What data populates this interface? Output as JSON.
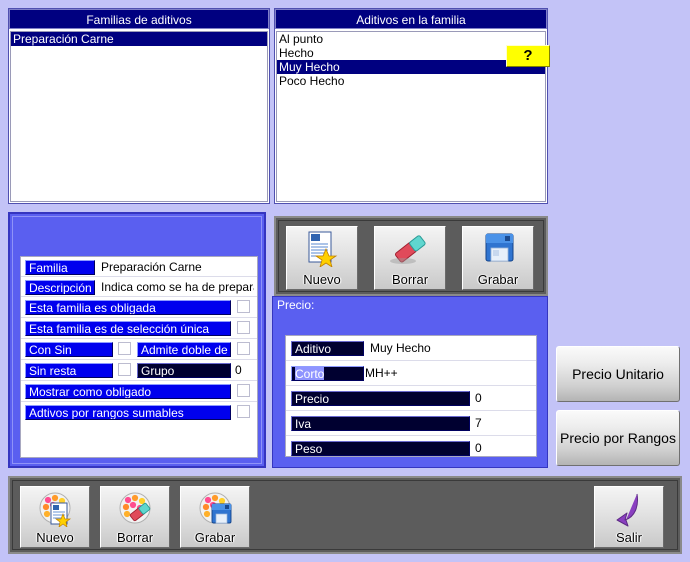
{
  "colors": {
    "background": "#c3c3f7",
    "panel_blue": "#5a5ff0",
    "header_navy": "#000080",
    "label_blue": "#0000ee",
    "toolbar_gray": "#5c5c5c",
    "help_yellow": "#ffff00",
    "exit_purple": "#7a3fb5"
  },
  "families_list": {
    "header": "Familias de aditivos",
    "items": [
      {
        "label": "Preparación Carne",
        "selected": true
      }
    ]
  },
  "additives_list": {
    "header": "Aditivos en la familia",
    "items": [
      {
        "label": "Al punto",
        "selected": false
      },
      {
        "label": "Hecho",
        "selected": false
      },
      {
        "label": "Muy Hecho",
        "selected": true
      },
      {
        "label": "Poco Hecho",
        "selected": false
      }
    ],
    "help_button": "?"
  },
  "family_form": {
    "rows": [
      {
        "label": "Familia",
        "value": "Preparación Carne",
        "type": "text"
      },
      {
        "label": "Descripción",
        "value": "Indica como se ha de preparar la",
        "type": "text"
      },
      {
        "label": "Esta familia es obligada",
        "value": "",
        "type": "check"
      },
      {
        "label": "Esta familia es de selección única",
        "value": "",
        "type": "check"
      },
      {
        "label": "Con Sin",
        "value": "",
        "type": "check"
      },
      {
        "label": "Admite doble de",
        "value": "",
        "type": "check"
      },
      {
        "label": "Sin resta",
        "value": "",
        "type": "check"
      },
      {
        "label": "Grupo",
        "value": "0",
        "type": "number"
      },
      {
        "label": "Mostrar como obligado",
        "value": "",
        "type": "check"
      },
      {
        "label": "Adtivos por rangos sumables",
        "value": "",
        "type": "check"
      }
    ]
  },
  "additive_toolbar": {
    "buttons": [
      {
        "label": "Nuevo",
        "icon": "new-document-icon"
      },
      {
        "label": "Borrar",
        "icon": "eraser-icon"
      },
      {
        "label": "Grabar",
        "icon": "floppy-disk-icon"
      }
    ]
  },
  "price_group": {
    "title": "Precio:",
    "rows": [
      {
        "label": "Aditivo",
        "value": "Muy Hecho",
        "style": "dark"
      },
      {
        "label": "Corto",
        "value": "MH++",
        "style": "highlighted"
      },
      {
        "label": "Precio",
        "value": "0",
        "style": "wide"
      },
      {
        "label": "Iva",
        "value": "7",
        "style": "wide"
      },
      {
        "label": "Peso",
        "value": "0",
        "style": "wide"
      }
    ]
  },
  "price_mode_buttons": [
    {
      "label": "Precio Unitario"
    },
    {
      "label": "Precio por Rangos"
    }
  ],
  "bottom_toolbar": {
    "buttons": [
      {
        "label": "Nuevo",
        "icon": "family-new-icon"
      },
      {
        "label": "Borrar",
        "icon": "family-eraser-icon"
      },
      {
        "label": "Grabar",
        "icon": "family-save-icon"
      }
    ],
    "exit_button": {
      "label": "Salir",
      "icon": "exit-arrow-icon"
    }
  }
}
